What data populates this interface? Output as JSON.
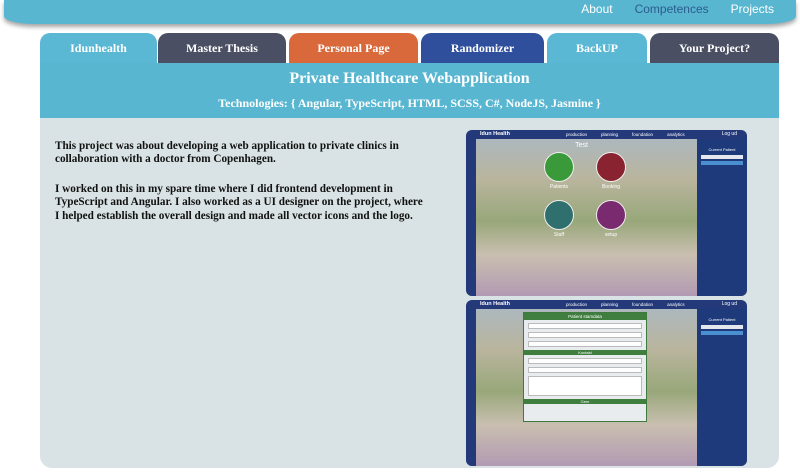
{
  "nav": {
    "links": [
      "About",
      "Competences",
      "Projects"
    ]
  },
  "tabs": [
    {
      "label": "Idunhealth",
      "color": "#5ab8d4"
    },
    {
      "label": "Master Thesis",
      "color": "#4a4f63"
    },
    {
      "label": "Personal Page",
      "color": "#d9693a"
    },
    {
      "label": "Randomizer",
      "color": "#2f4f9c"
    },
    {
      "label": "BackUP",
      "color": "#5ab8d4"
    },
    {
      "label": "Your Project?",
      "color": "#4a4f63"
    }
  ],
  "project": {
    "title": "Private Healthcare Webapplication",
    "technologies": "Technologies: { Angular, TypeScript, HTML, SCSS, C#, NodeJS, Jasmine }",
    "paragraphs": [
      "This project was about developing a web application to private clinics in collaboration with a doctor from Copenhagen.",
      "I worked on this in my spare time where I did frontend development in TypeScript and Angular. I also worked as a UI designer on the project, where I helped establish the overall design and made all vector icons and the logo."
    ]
  },
  "screens": {
    "app_name": "Idun Health",
    "logout": "Log ud",
    "menu": [
      "production",
      "planning",
      "foundation",
      "analytics"
    ],
    "current_patient": "Current Patient",
    "main_label": "Test",
    "tiles": [
      "Patients",
      "Booking",
      "Staff",
      "setup"
    ],
    "form_title": "Patient stamdata",
    "form_section": "Kontakt",
    "form_save": "Gem"
  }
}
